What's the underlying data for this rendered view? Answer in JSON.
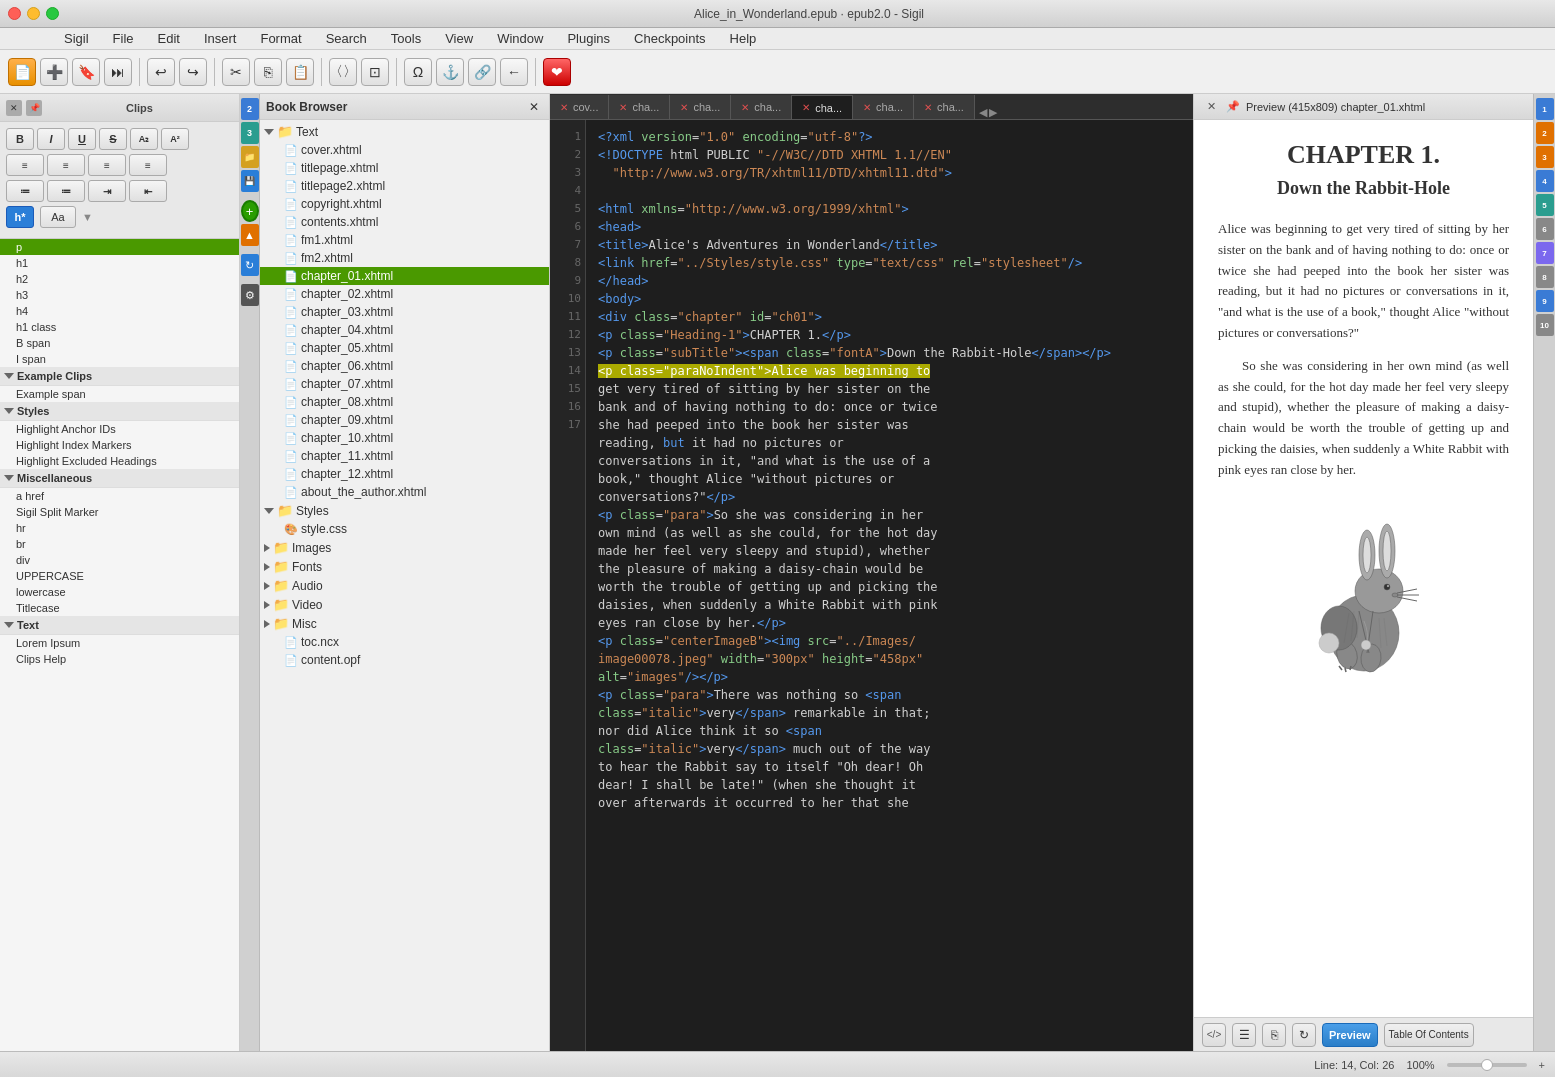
{
  "window": {
    "title": "Alice_in_Wonderland.epub · epub2.0 - Sigil"
  },
  "menubar": {
    "items": [
      "Sigil",
      "File",
      "Edit",
      "Insert",
      "Format",
      "Search",
      "Tools",
      "View",
      "Window",
      "Plugins",
      "Checkpoints",
      "Help"
    ]
  },
  "toolbar": {
    "buttons": [
      "⊕",
      "✎",
      "⚑",
      "⟳",
      "↷",
      "↶",
      "↷",
      "✂",
      "⎘",
      "⎙",
      "〈〉",
      "⊡",
      "Ω",
      "⚓",
      "⛓",
      "←",
      "❤"
    ]
  },
  "clips": {
    "title": "Clips",
    "formatting": {
      "bold": "B",
      "italic": "I",
      "underline": "U",
      "strikethrough": "S",
      "sub": "A₂",
      "sup": "A²"
    },
    "items_selected": "p",
    "items": [
      {
        "label": "p",
        "selected": true
      },
      {
        "label": "h1",
        "selected": false
      },
      {
        "label": "h2",
        "selected": false
      },
      {
        "label": "h3",
        "selected": false
      },
      {
        "label": "h4",
        "selected": false
      },
      {
        "label": "h1 class",
        "selected": false
      },
      {
        "label": "B span",
        "selected": false
      },
      {
        "label": "I span",
        "selected": false
      }
    ],
    "groups": [
      {
        "name": "Example Clips",
        "items": [
          "Example span"
        ]
      },
      {
        "name": "Styles",
        "items": [
          "Highlight Anchor IDs",
          "Highlight Index Markers",
          "Highlight Excluded Headings"
        ]
      },
      {
        "name": "Miscellaneous",
        "items": [
          "a href",
          "Sigil Split Marker",
          "hr",
          "br",
          "div",
          "UPPERCASE",
          "lowercase",
          "Titlecase"
        ]
      },
      {
        "name": "Text",
        "items": [
          "Lorem Ipsum",
          "Clips Help"
        ]
      }
    ]
  },
  "book_browser": {
    "title": "Book Browser",
    "close_btn": "✕",
    "tree": [
      {
        "type": "folder",
        "label": "Text",
        "expanded": true,
        "children": [
          {
            "type": "file",
            "label": "cover.xhtml"
          },
          {
            "type": "file",
            "label": "titlepage.xhtml"
          },
          {
            "type": "file",
            "label": "titlepage2.xhtml"
          },
          {
            "type": "file",
            "label": "copyright.xhtml"
          },
          {
            "type": "file",
            "label": "contents.xhtml"
          },
          {
            "type": "file",
            "label": "fm1.xhtml"
          },
          {
            "type": "file",
            "label": "fm2.xhtml"
          },
          {
            "type": "file",
            "label": "chapter_01.xhtml",
            "selected": true
          },
          {
            "type": "file",
            "label": "chapter_02.xhtml"
          },
          {
            "type": "file",
            "label": "chapter_03.xhtml"
          },
          {
            "type": "file",
            "label": "chapter_04.xhtml"
          },
          {
            "type": "file",
            "label": "chapter_05.xhtml"
          },
          {
            "type": "file",
            "label": "chapter_06.xhtml"
          },
          {
            "type": "file",
            "label": "chapter_07.xhtml"
          },
          {
            "type": "file",
            "label": "chapter_08.xhtml"
          },
          {
            "type": "file",
            "label": "chapter_09.xhtml"
          },
          {
            "type": "file",
            "label": "chapter_10.xhtml"
          },
          {
            "type": "file",
            "label": "chapter_11.xhtml"
          },
          {
            "type": "file",
            "label": "chapter_12.xhtml"
          },
          {
            "type": "file",
            "label": "about_the_author.xhtml"
          }
        ]
      },
      {
        "type": "folder",
        "label": "Styles",
        "expanded": true,
        "children": [
          {
            "type": "css",
            "label": "style.css"
          }
        ]
      },
      {
        "type": "folder",
        "label": "Images",
        "expanded": false,
        "children": []
      },
      {
        "type": "folder",
        "label": "Fonts",
        "expanded": false,
        "children": []
      },
      {
        "type": "folder",
        "label": "Audio",
        "expanded": false,
        "children": []
      },
      {
        "type": "folder",
        "label": "Video",
        "expanded": false,
        "children": []
      },
      {
        "type": "folder",
        "label": "Misc",
        "expanded": false,
        "children": []
      },
      {
        "type": "file-plain",
        "label": "toc.ncx"
      },
      {
        "type": "file-plain",
        "label": "content.opf"
      }
    ]
  },
  "tabs": [
    {
      "label": "cov...",
      "active": false
    },
    {
      "label": "cha...",
      "active": false
    },
    {
      "label": "cha...",
      "active": false
    },
    {
      "label": "cha...",
      "active": false
    },
    {
      "label": "cha...",
      "active": true
    },
    {
      "label": "cha...",
      "active": false
    },
    {
      "label": "cha...",
      "active": false
    }
  ],
  "editor": {
    "lines": [
      {
        "num": 1,
        "code": "<?xml version=\"1.0\" encoding=\"utf-8\"?>"
      },
      {
        "num": 2,
        "code": "<!DOCTYPE html PUBLIC \"-//W3C//DTD XHTML 1.1//EN\""
      },
      {
        "num": 3,
        "code": "  \"http://www.w3.org/TR/xhtml11/DTD/xhtml11.dtd\">"
      },
      {
        "num": 4,
        "code": ""
      },
      {
        "num": 5,
        "code": "<html xmlns=\"http://www.w3.org/1999/xhtml\">"
      },
      {
        "num": 6,
        "code": "<head>"
      },
      {
        "num": 7,
        "code": "<title>Alice's Adventures in Wonderland</title>"
      },
      {
        "num": 8,
        "code": "<link href=\"../Styles/style.css\" type=\"text/css\" rel=\"stylesheet\"/>"
      },
      {
        "num": 9,
        "code": "</head>"
      },
      {
        "num": 10,
        "code": "<body>"
      },
      {
        "num": 11,
        "code": "<div class=\"chapter\" id=\"ch01\">"
      },
      {
        "num": 12,
        "code": "<p class=\"Heading-1\">CHAPTER 1.</p>"
      },
      {
        "num": 13,
        "code": "<p class=\"subTitle\"><span class=\"fontA\">Down the Rabbit-Hole</span></p>"
      },
      {
        "num": 14,
        "code": "<p class=\"paraNoIndent\">Alice was beginning to get very tired of sitting by her sister on the bank and of having nothing to do: once or twice she had peeped into the book her sister was reading, but it had no pictures or conversations in it, \"and what is the use of a book,\" thought Alice \"without pictures or conversations?\""
      },
      {
        "num": 15,
        "code": "<p class=\"para\">So she was considering in her own mind (as well as she could, for the hot day made her feel very sleepy and stupid), whether the pleasure of making a daisy-chain would be worth the trouble of getting up and picking the daisies, when suddenly a White Rabbit with pink eyes ran close by her.</p>"
      },
      {
        "num": 16,
        "code": "<p class=\"centerImageB\"><img src=\"../Images/image00078.jpeg\" width=\"300px\" height=\"458px\" alt=\"images\"/></p>"
      },
      {
        "num": 17,
        "code": "<p class=\"para\">There was nothing so <span class=\"italic\">very</span> remarkable in that; nor did Alice think it so <span class=\"italic\">very</span> much out of the way to hear the Rabbit say to itself \"Oh dear! Oh dear! I shall be late!\" (when she thought it over afterwards it occurred to her that she"
      }
    ]
  },
  "preview": {
    "header": "Preview (415x809) chapter_01.xhtml",
    "chapter_title": "CHAPTER 1.",
    "subtitle": "Down the Rabbit-Hole",
    "paragraphs": [
      "Alice was beginning to get very tired of sitting by her sister on the bank and of having nothing to do: once or twice she had peeped into the book her sister was reading, but it had no pictures or conversations in it, \"and what is the use of a book,\" thought Alice \"without pictures or conversations?\"",
      "So she was considering in her own mind (as well as she could, for the hot day made her feel very sleepy and stupid), whether the pleasure of making a daisy-chain would be worth the trouble of getting up and picking the daisies, when suddenly a White Rabbit with pink eyes ran close by her."
    ],
    "footer": {
      "preview_label": "Preview",
      "toc_label": "Table Of Contents"
    }
  },
  "statusbar": {
    "line_col": "Line: 14, Col: 26",
    "zoom": "100%"
  },
  "side_numbers": [
    "2",
    "3",
    "4",
    "5",
    "6",
    "7",
    "8",
    "9",
    "10"
  ]
}
